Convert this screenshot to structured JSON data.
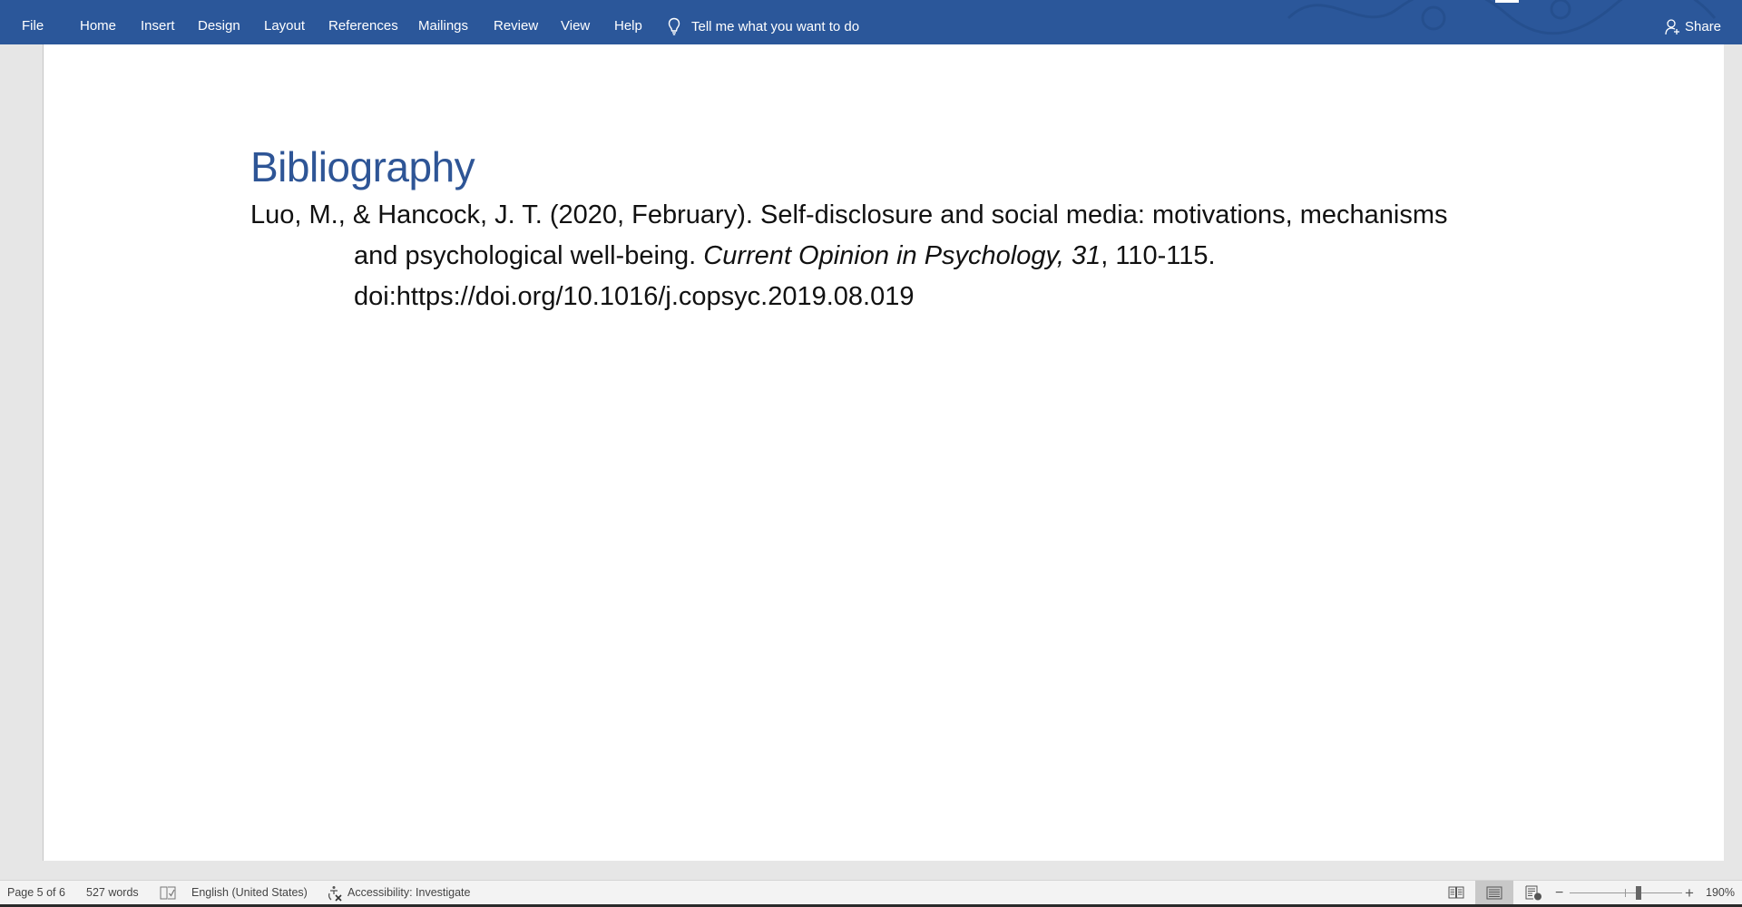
{
  "ribbon": {
    "tabs": [
      "File",
      "Home",
      "Insert",
      "Design",
      "Layout",
      "References",
      "Mailings",
      "Review",
      "View",
      "Help"
    ],
    "tell_me": "Tell me what you want to do",
    "share": "Share",
    "accent_color": "#2b579a"
  },
  "document": {
    "heading": "Bibliography",
    "reference": {
      "line1": "Luo, M., & Hancock, J. T. (2020, February). Self-disclosure and social media: motivations, mechanisms",
      "line2_pre": "and psychological well-being. ",
      "line2_journal": "Current Opinion in Psychology, 31",
      "line2_post": ", 110-115.",
      "line3": "doi:https://doi.org/10.1016/j.copsyc.2019.08.019"
    },
    "heading_color": "#2e5596"
  },
  "statusbar": {
    "page": "Page 5 of 6",
    "words": "527 words",
    "proofing_icon": "proofing-check-icon",
    "language": "English (United States)",
    "accessibility": "Accessibility: Investigate",
    "views": [
      "Read Mode",
      "Print Layout",
      "Web Layout"
    ],
    "active_view": "Print Layout",
    "zoom": "190%"
  }
}
